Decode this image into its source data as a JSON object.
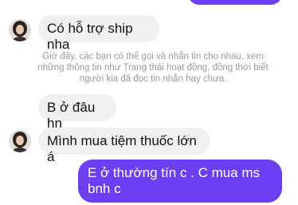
{
  "chat": {
    "messages": [
      {
        "from": "contact",
        "text": "Có hỗ trợ ship nha"
      },
      {
        "from": "contact",
        "text": "B ở đâu hn"
      },
      {
        "from": "contact",
        "text": "Mình mua tiệm thuốc lớn á"
      },
      {
        "from": "me",
        "text": "E ở thường tín c . C mua ms bnh c"
      }
    ],
    "notice": "Giờ đây, các bạn có thể gọi và nhắn tin cho nhau, xem những thông tin như Trạng thái hoạt động, đồng thời biết người kia đã đọc tin nhắn hay chưa.",
    "colors": {
      "outgoing": "#6b3ff2",
      "incoming": "#f0f0f0",
      "notice": "#9a9a9a"
    }
  }
}
